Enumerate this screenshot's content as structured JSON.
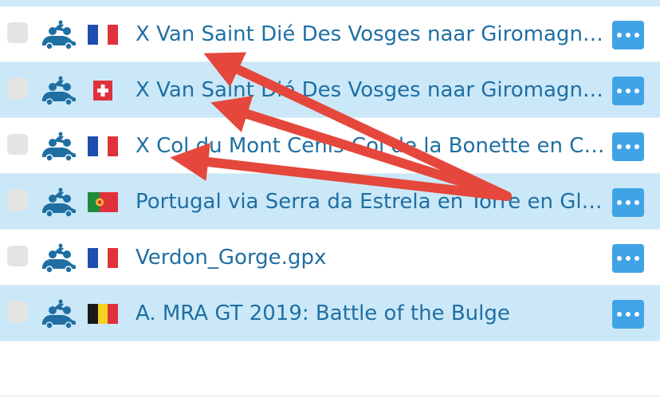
{
  "colors": {
    "row_highlight": "#cbe8f8",
    "link_text": "#1f6fa3",
    "more_button": "#3fa3e6",
    "annotation_arrow": "#e5473c"
  },
  "icons": {
    "vehicle": "motorcycle-and-car-icon",
    "more": "ellipsis-icon",
    "checkbox": "checkbox-unchecked"
  },
  "routes": [
    {
      "title": "X Van Saint Dié Des Vosges naar Giromagny ...",
      "flag": "france",
      "checked": false
    },
    {
      "title": "X Van Saint Dié Des Vosges naar Giromagny ...",
      "flag": "switzerland",
      "checked": false
    },
    {
      "title": "X Col du Mont Cenis-Col de la Bonette en Co...",
      "flag": "france",
      "checked": false
    },
    {
      "title": "Portugal via Serra da Estrela en Torre en Gla...",
      "flag": "portugal",
      "checked": false
    },
    {
      "title": "Verdon_Gorge.gpx",
      "flag": "france",
      "checked": false
    },
    {
      "title": "A. MRA GT 2019: Battle of the Bulge",
      "flag": "belgium",
      "checked": false
    }
  ]
}
